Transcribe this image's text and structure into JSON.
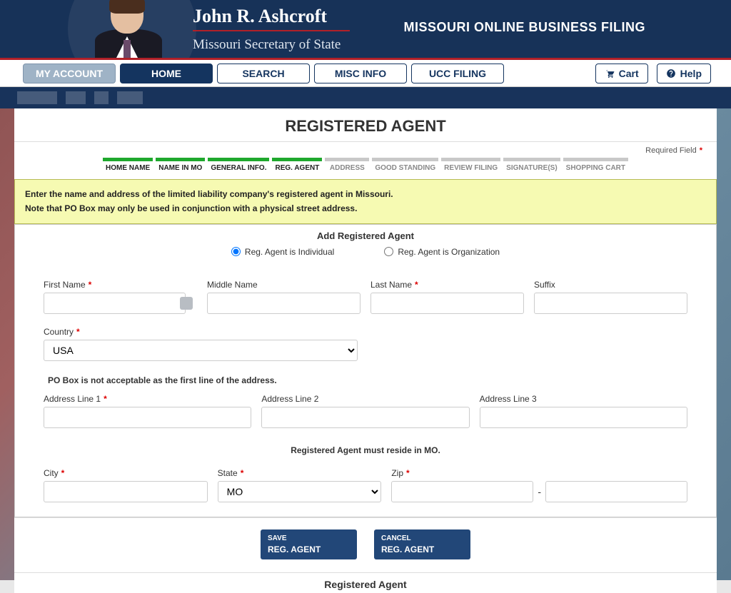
{
  "banner": {
    "name": "John R. Ashcroft",
    "subtitle": "Missouri Secretary of State",
    "app_title": "MISSOURI ONLINE BUSINESS FILING"
  },
  "nav": {
    "my_account": "MY ACCOUNT",
    "home": "HOME",
    "search": "SEARCH",
    "misc_info": "MISC INFO",
    "ucc_filing": "UCC FILING",
    "cart": "Cart",
    "help": "Help"
  },
  "page_title": "REGISTERED AGENT",
  "required_label": "Required Field",
  "steps": [
    {
      "label": "HOME NAME",
      "state": "done"
    },
    {
      "label": "NAME IN MO",
      "state": "done"
    },
    {
      "label": "GENERAL INFO.",
      "state": "done"
    },
    {
      "label": "REG. AGENT",
      "state": "active"
    },
    {
      "label": "ADDRESS",
      "state": "todo"
    },
    {
      "label": "GOOD STANDING",
      "state": "todo"
    },
    {
      "label": "REVIEW FILING",
      "state": "todo"
    },
    {
      "label": "SIGNATURE(S)",
      "state": "todo"
    },
    {
      "label": "SHOPPING CART",
      "state": "todo"
    }
  ],
  "instruction": {
    "line1": "Enter the name and address of the limited liability company's registered agent in Missouri.",
    "line2": "Note that PO Box may only be used in conjunction with a physical street address."
  },
  "form_heading": "Add Registered Agent",
  "agent_type": {
    "individual": "Reg. Agent is Individual",
    "organization": "Reg. Agent is Organization",
    "selected": "individual"
  },
  "labels": {
    "first_name": "First Name",
    "middle_name": "Middle Name",
    "last_name": "Last Name",
    "suffix": "Suffix",
    "country": "Country",
    "po_box_note": "PO Box is not acceptable as the first line of the address.",
    "address1": "Address Line 1",
    "address2": "Address Line 2",
    "address3": "Address Line 3",
    "reside_note": "Registered Agent must reside in MO.",
    "city": "City",
    "state": "State",
    "zip": "Zip"
  },
  "fields": {
    "first_name": "",
    "middle_name": "",
    "last_name": "",
    "suffix": "",
    "country": "USA",
    "country_options": [
      "USA"
    ],
    "address1": "",
    "address2": "",
    "address3": "",
    "city": "",
    "state": "MO",
    "state_options": [
      "MO"
    ],
    "zip1": "",
    "zip2": ""
  },
  "buttons": {
    "save_small": "SAVE",
    "save_big": "REG. AGENT",
    "cancel_small": "CANCEL",
    "cancel_big": "REG. AGENT"
  },
  "lower_section_title": "Registered Agent"
}
